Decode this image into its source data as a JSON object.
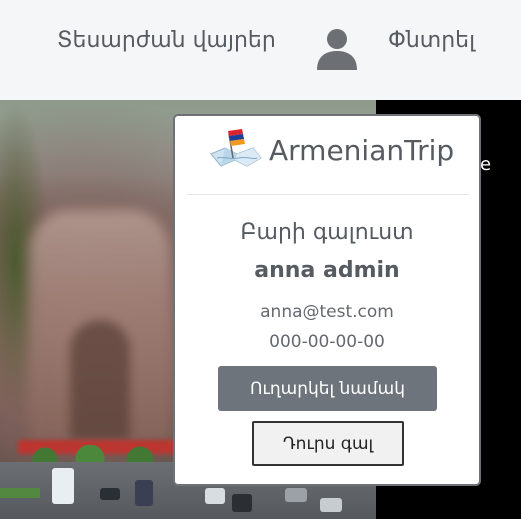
{
  "navbar": {
    "places_label": "Տեսարժան վայրեր",
    "search_label": "Փնտրել"
  },
  "hero": {
    "caption_partial": "e"
  },
  "popup": {
    "brand_name": "ArmenianTrip",
    "welcome": "Բարի գալուստ",
    "username": "anna admin",
    "email": "anna@test.com",
    "phone": "000-00-00-00",
    "send_message_label": "Ուղարկել նամակ",
    "logout_label": "Դուրս գալ"
  },
  "colors": {
    "navbar_bg": "#f5f6f7",
    "text": "#555b61",
    "button_secondary": "#6e747b",
    "flag_red": "#d9232e",
    "flag_blue": "#1b3f9a",
    "flag_orange": "#f29a1f"
  },
  "icons": {
    "user": "user-icon",
    "brand_logo": "map-flag-logo-icon"
  }
}
